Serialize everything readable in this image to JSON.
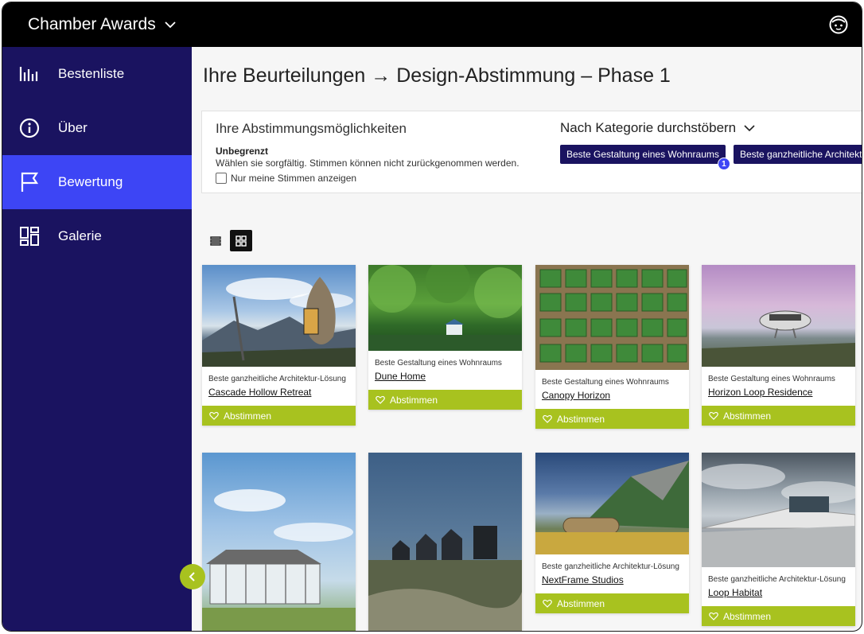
{
  "header": {
    "app_title": "Chamber Awards"
  },
  "sidebar": {
    "items": [
      {
        "label": "Bestenliste",
        "icon": "leaderboard-icon"
      },
      {
        "label": "Über",
        "icon": "info-icon"
      },
      {
        "label": "Bewertung",
        "icon": "flag-icon",
        "active": true
      },
      {
        "label": "Galerie",
        "icon": "gallery-icon"
      }
    ]
  },
  "page": {
    "title": "Ihre Beurteilungen → Design-Abstimmung – Phase 1"
  },
  "options": {
    "heading": "Ihre Abstimmungsmöglichkeiten",
    "limit_label": "Unbegrenzt",
    "description": "Wählen sie sorgfältig. Stimmen können nicht zurückgenommen werden.",
    "checkbox_label": "Nur meine Stimmen anzeigen",
    "checkbox_checked": false
  },
  "categories": {
    "heading": "Nach Kategorie durchstöbern",
    "pills": [
      {
        "label": "Beste Gestaltung eines Wohnraums",
        "badge": "1"
      },
      {
        "label": "Beste ganzheitliche Architektur-Lösung"
      }
    ]
  },
  "view": {
    "mode": "grid"
  },
  "vote_label": "Abstimmen",
  "entries": [
    {
      "category": "Beste ganzheitliche Architektur-Lösung",
      "title": "Cascade Hollow Retreat"
    },
    {
      "category": "Beste Gestaltung eines Wohnraums",
      "title": "Dune Home"
    },
    {
      "category": "Beste Gestaltung eines Wohnraums",
      "title": "Canopy Horizon"
    },
    {
      "category": "Beste Gestaltung eines Wohnraums",
      "title": "Horizon Loop Residence"
    },
    {
      "category": "",
      "title": ""
    },
    {
      "category": "",
      "title": ""
    },
    {
      "category": "Beste ganzheitliche Architektur-Lösung",
      "title": "NextFrame Studios"
    },
    {
      "category": "Beste ganzheitliche Architektur-Lösung",
      "title": "Loop Habitat"
    }
  ],
  "colors": {
    "sidebar_bg": "#1a1360",
    "active_nav": "#3d45f5",
    "vote_green": "#a8c21f",
    "topbar": "#000000"
  }
}
